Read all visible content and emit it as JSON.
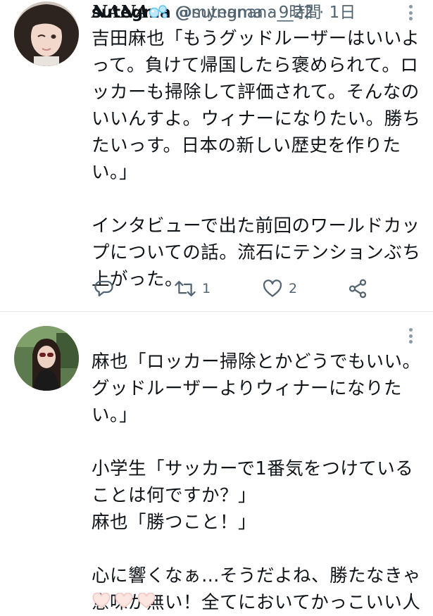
{
  "tweets": [
    {
      "display_name": "sutegma",
      "handle": "@sutegma",
      "separator": "·",
      "time": "9時間",
      "text": "吉田麻也「もうグッドルーザーはいいよって。負けて帰国したら褒められて。ロッカーも掃除して評価されて。そんなのいいんすよ。ウィナーになりたい。勝ちたいっす。日本の新しい歴史を作りたい。」\n\nインタビューで出た前回のワールドカップについての話。流石にテンションぶち上がった。",
      "reply_icon": "reply-icon",
      "retweet_icon": "retweet-icon",
      "retweet_count": "1",
      "like_icon": "heart-icon",
      "like_count": "2",
      "share_icon": "share-icon"
    },
    {
      "display_name": "NANA",
      "name_emoji": "bubbles-emoji",
      "handle": "@mynanana__22",
      "separator": "·",
      "time": "1日",
      "text": "麻也「ロッカー掃除とかどうでもいい。グッドルーザーよりウィナーになりたい。」\n\n小学生「サッカーで1番気をつけていることは何ですか？」\n麻也「勝つこと！」\n\n心に響くなぁ…そうだよね、勝たなきゃ意味が無い！全てにおいてかっこいい人",
      "trailing_emoji": "hearts-emoji",
      "colors": {
        "heart_emoji": "#f6c7c0"
      }
    }
  ],
  "colors": {
    "text": "#0f1419",
    "muted": "#536471",
    "divider": "#e6e9ec",
    "bubble": "#5cc4ef"
  }
}
